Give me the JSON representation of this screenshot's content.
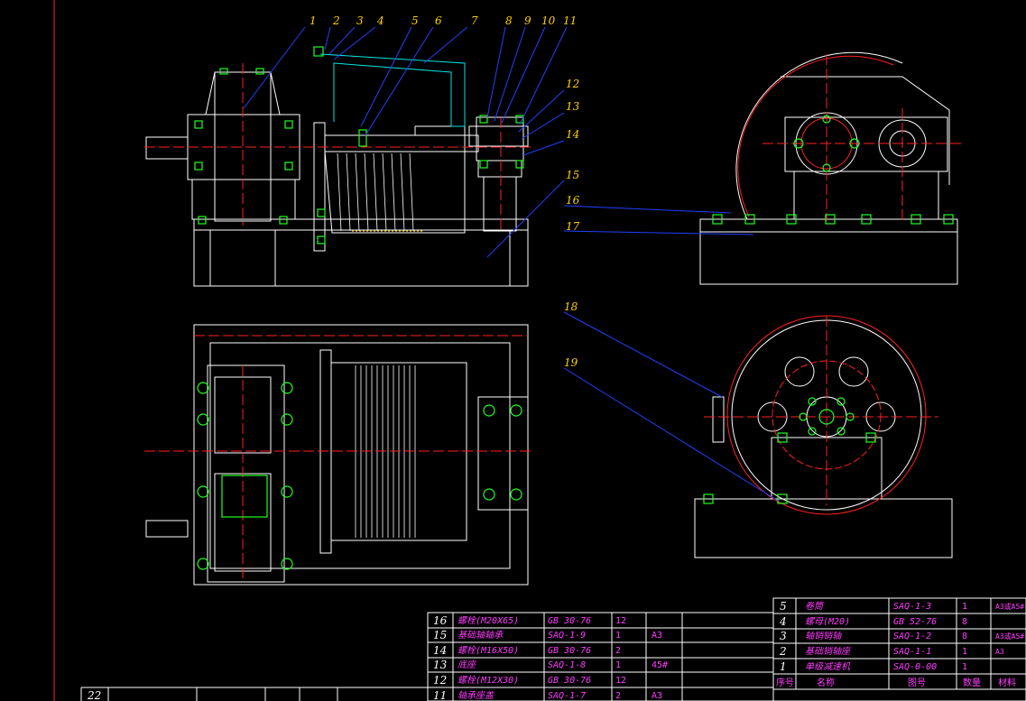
{
  "drawing": {
    "callouts": [
      "1",
      "2",
      "3",
      "4",
      "5",
      "6",
      "7",
      "8",
      "9",
      "10",
      "11",
      "12",
      "13",
      "14",
      "15",
      "16",
      "17",
      "18",
      "19"
    ]
  },
  "bom_left": {
    "rows": [
      {
        "no": "16",
        "name": "螺栓(M20X65)",
        "code": "GB 30-76",
        "qty": "12",
        "mat": ""
      },
      {
        "no": "15",
        "name": "基础轴轴承",
        "code": "SAQ-1-9",
        "qty": "1",
        "mat": "A3"
      },
      {
        "no": "14",
        "name": "螺栓(M16X50)",
        "code": "GB 30-76",
        "qty": "2",
        "mat": ""
      },
      {
        "no": "13",
        "name": "底座",
        "code": "SAQ-1-8",
        "qty": "1",
        "mat": "45#"
      },
      {
        "no": "12",
        "name": "螺栓(M12X30)",
        "code": "GB 30-76",
        "qty": "12",
        "mat": ""
      },
      {
        "no": "11",
        "name": "轴承座盖",
        "code": "SAQ-1-7",
        "qty": "2",
        "mat": "A3"
      }
    ],
    "bottom_no": "22"
  },
  "bom_right": {
    "rows": [
      {
        "no": "5",
        "name": "卷筒",
        "code": "SAQ-1-3",
        "qty": "1",
        "mat": "A3或A5#"
      },
      {
        "no": "4",
        "name": "螺母(M20)",
        "code": "GB 52-76",
        "qty": "8",
        "mat": ""
      },
      {
        "no": "3",
        "name": "轴销销轴",
        "code": "SAQ-1-2",
        "qty": "8",
        "mat": "A3或A5#"
      },
      {
        "no": "2",
        "name": "基础销轴座",
        "code": "SAQ-1-1",
        "qty": "1",
        "mat": "A3"
      },
      {
        "no": "1",
        "name": "单级减速机",
        "code": "SAQ-0-00",
        "qty": "1",
        "mat": ""
      }
    ],
    "header": {
      "no": "序号",
      "name": "名称",
      "code": "图号",
      "qty": "数量",
      "mat": "材料"
    }
  },
  "colors": {
    "outline": "#ffffff",
    "centerline": "#ff2020",
    "bolt": "#20ff20",
    "leader": "#2040ff",
    "callout": "#ffd200",
    "section": "#00e5e5",
    "table_text": "#ff3cff",
    "hidden": "#ffff30"
  }
}
